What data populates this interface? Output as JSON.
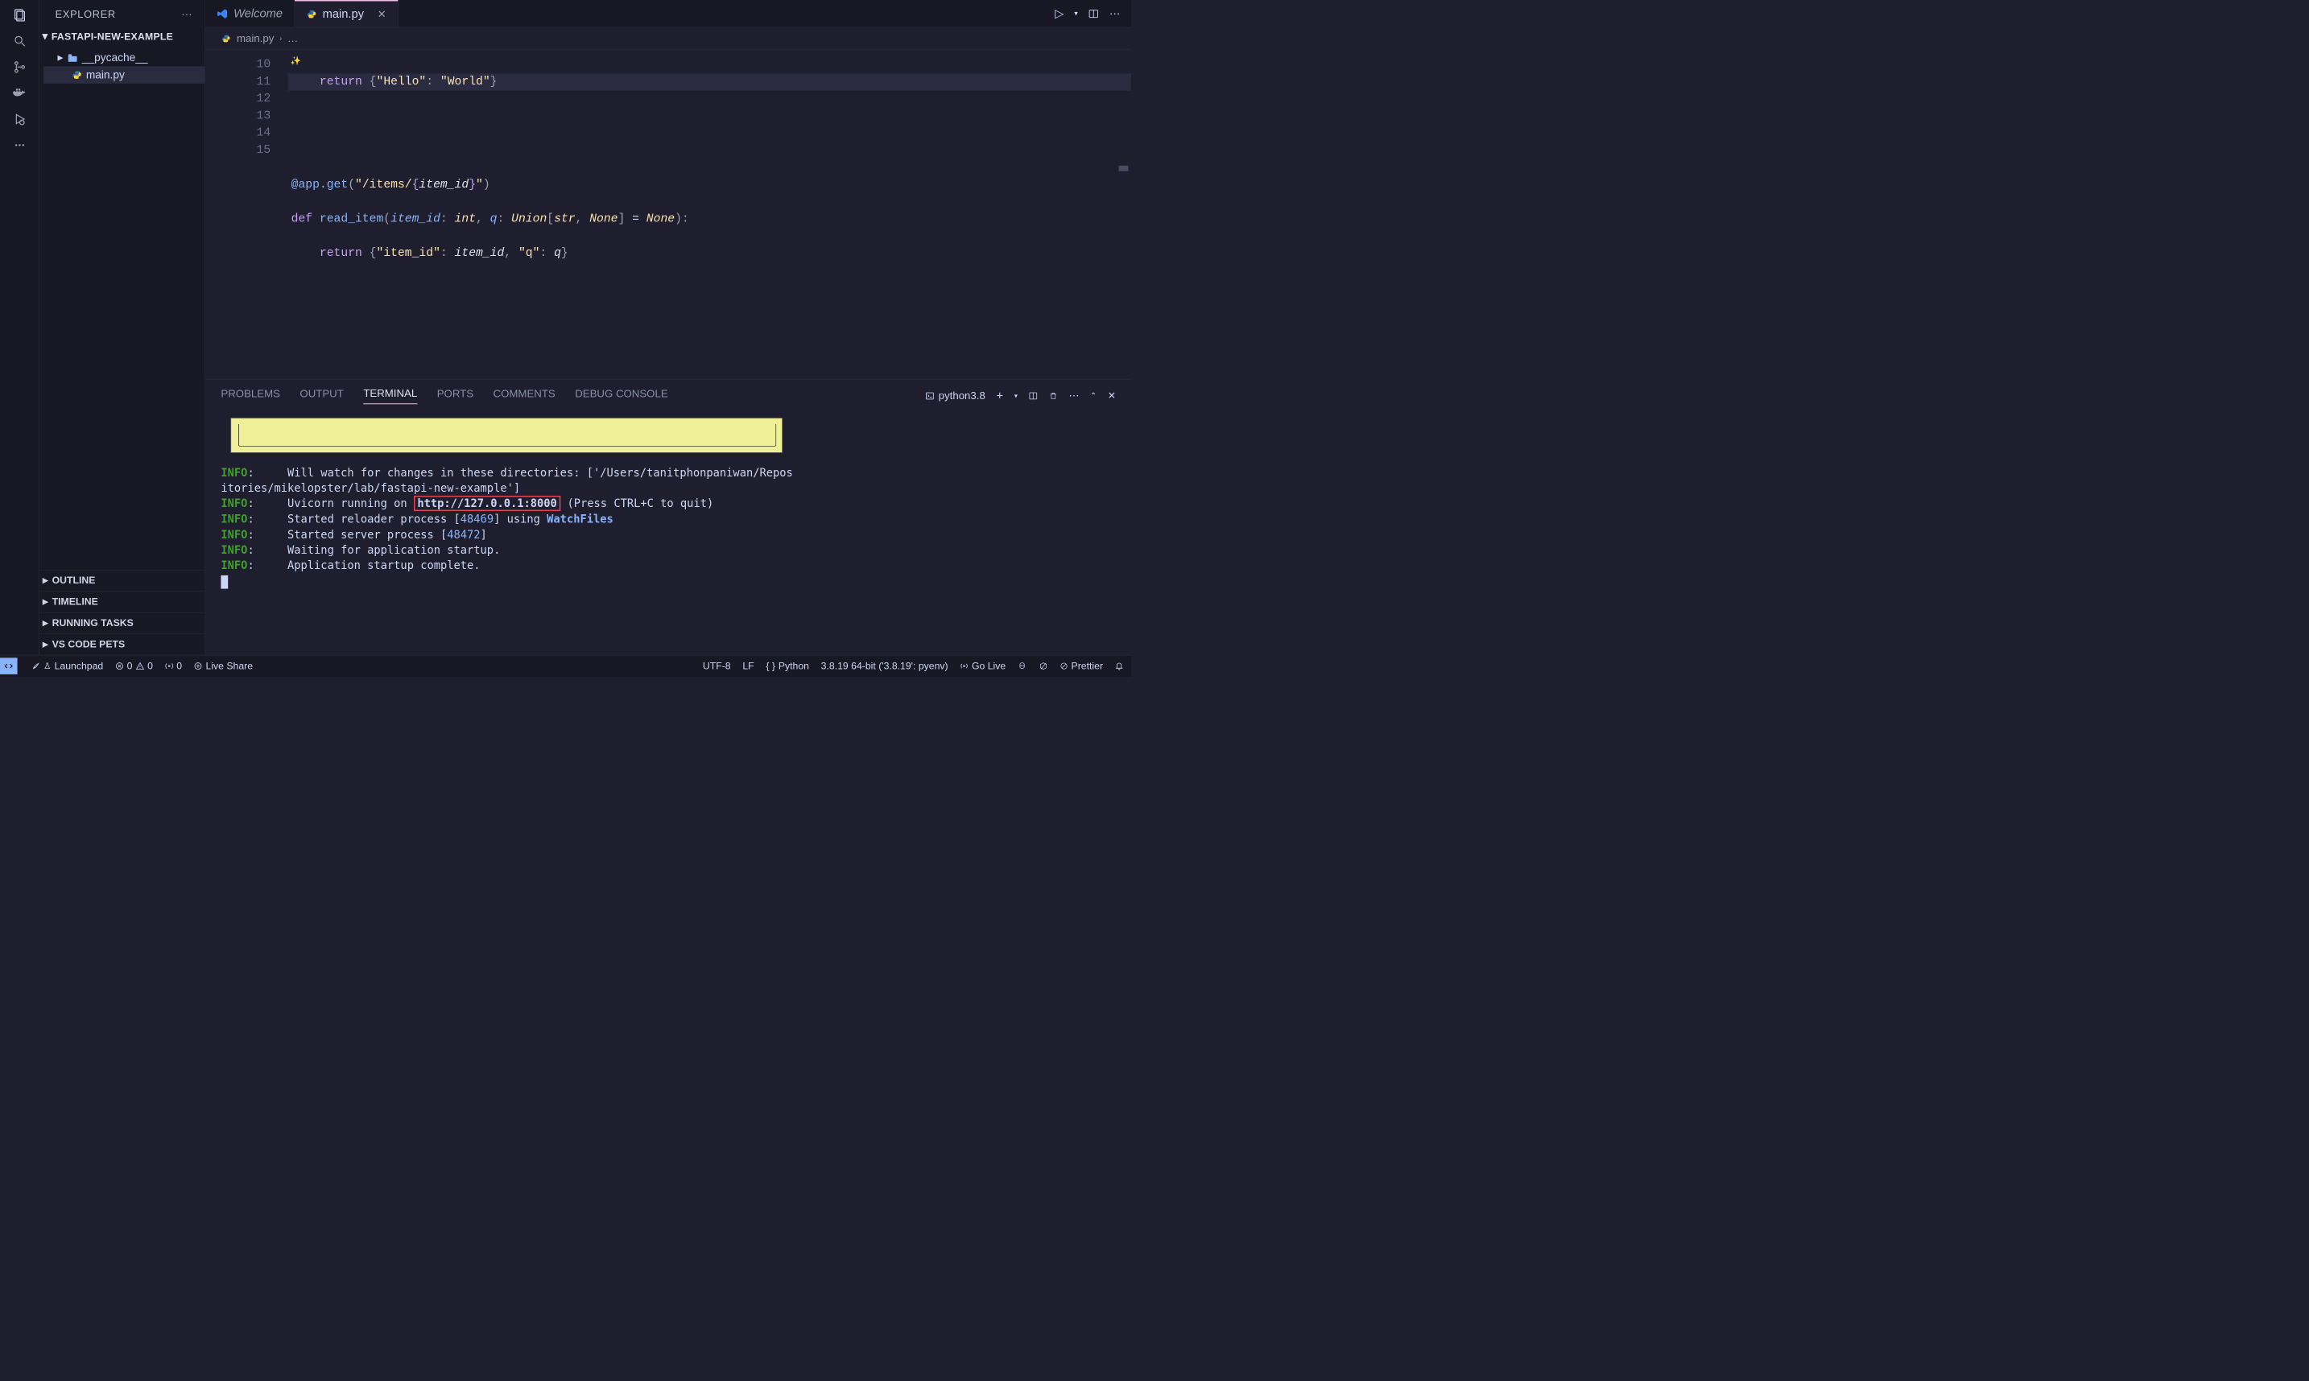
{
  "sidebar": {
    "title": "EXPLORER",
    "project": "FASTAPI-NEW-EXAMPLE",
    "tree": {
      "folder": "__pycache__",
      "file": "main.py"
    },
    "footer": [
      "OUTLINE",
      "TIMELINE",
      "RUNNING TASKS",
      "VS CODE PETS"
    ]
  },
  "tabs": {
    "welcome": "Welcome",
    "file": "main.py"
  },
  "tab_actions": {
    "run": "▷"
  },
  "breadcrumb": {
    "file": "main.py",
    "tail": "…"
  },
  "editor": {
    "line_start": 10,
    "lines": {
      "l10_indent": "    ",
      "l10_return": "return",
      "l10_s1": "\"Hello\"",
      "l10_s2": "\"World\"",
      "l13_deco_at": "@app",
      "l13_deco_get": ".get",
      "l13_route_open": "(\"",
      "l13_route": "/items/",
      "l13_route_brace_l": "{",
      "l13_route_var": "item_id",
      "l13_route_brace_r": "}",
      "l13_route_close": "\")",
      "l14_def": "def",
      "l14_name": "read_item",
      "l14_p1": "item_id",
      "l14_t1": "int",
      "l14_p2": "q",
      "l14_t2a": "Union",
      "l14_t2b": "str",
      "l14_t2c": "None",
      "l14_defv": "None",
      "l15_indent": "    ",
      "l15_return": "return",
      "l15_k1": "\"item_id\"",
      "l15_v1": "item_id",
      "l15_k2": "\"q\"",
      "l15_v2": "q"
    }
  },
  "panel": {
    "tabs": [
      "PROBLEMS",
      "OUTPUT",
      "TERMINAL",
      "PORTS",
      "COMMENTS",
      "DEBUG CONSOLE"
    ],
    "active_tab": "TERMINAL",
    "profile": "python3.8"
  },
  "terminal": {
    "info": "INFO",
    "l1a": "     Will watch for changes in these directories: ['/Users/tanitphonpaniwan/Repos",
    "l1b": "itories/mikelopster/lab/fastapi-new-example']",
    "l2a": "     Uvicorn running on ",
    "l2url": "http://127.0.0.1:8000",
    "l2b": " (Press CTRL+C to quit)",
    "l3a": "     Started reloader process [",
    "l3pid": "48469",
    "l3b": "] using ",
    "l3watch": "WatchFiles",
    "l4a": "     Started server process [",
    "l4pid": "48472",
    "l4b": "]",
    "l5": "     Waiting for application startup.",
    "l6": "     Application startup complete."
  },
  "status": {
    "launchpad": "Launchpad",
    "errors": "0",
    "warnings": "0",
    "ports": "0",
    "liveshare": "Live Share",
    "encoding": "UTF-8",
    "eol": "LF",
    "lang": "Python",
    "interpreter": "3.8.19 64-bit ('3.8.19': pyenv)",
    "golive": "Go Live",
    "prettier": "Prettier"
  }
}
